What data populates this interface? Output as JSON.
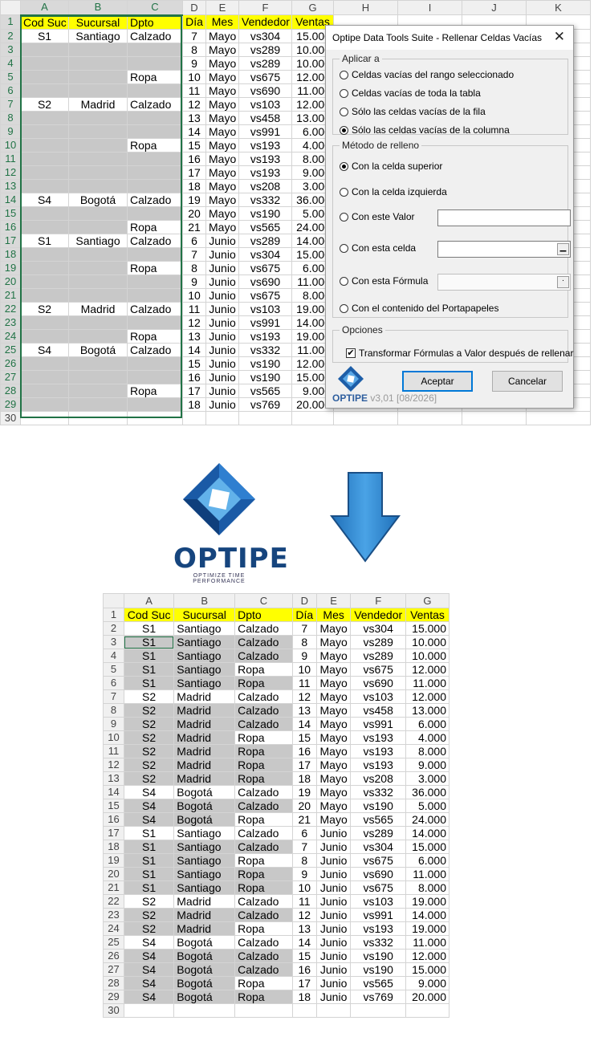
{
  "columns": [
    "A",
    "B",
    "C",
    "D",
    "E",
    "F",
    "G",
    "H",
    "I",
    "J",
    "K"
  ],
  "headers": [
    "Cod Suc",
    "Sucursal",
    "Dpto",
    "Día",
    "Mes",
    "Vendedor",
    "Ventas"
  ],
  "rows_before": [
    {
      "n": "2",
      "a": "S1",
      "b": "Santiago",
      "c": "Calzado",
      "d": "7",
      "e": "Mayo",
      "f": "vs304",
      "g": "15.000"
    },
    {
      "n": "3",
      "a": "",
      "b": "",
      "c": "",
      "d": "8",
      "e": "Mayo",
      "f": "vs289",
      "g": "10.000"
    },
    {
      "n": "4",
      "a": "",
      "b": "",
      "c": "",
      "d": "9",
      "e": "Mayo",
      "f": "vs289",
      "g": "10.000"
    },
    {
      "n": "5",
      "a": "",
      "b": "",
      "c": "Ropa",
      "d": "10",
      "e": "Mayo",
      "f": "vs675",
      "g": "12.000"
    },
    {
      "n": "6",
      "a": "",
      "b": "",
      "c": "",
      "d": "11",
      "e": "Mayo",
      "f": "vs690",
      "g": "11.000"
    },
    {
      "n": "7",
      "a": "S2",
      "b": "Madrid",
      "c": "Calzado",
      "d": "12",
      "e": "Mayo",
      "f": "vs103",
      "g": "12.000"
    },
    {
      "n": "8",
      "a": "",
      "b": "",
      "c": "",
      "d": "13",
      "e": "Mayo",
      "f": "vs458",
      "g": "13.000"
    },
    {
      "n": "9",
      "a": "",
      "b": "",
      "c": "",
      "d": "14",
      "e": "Mayo",
      "f": "vs991",
      "g": "6.000"
    },
    {
      "n": "10",
      "a": "",
      "b": "",
      "c": "Ropa",
      "d": "15",
      "e": "Mayo",
      "f": "vs193",
      "g": "4.000"
    },
    {
      "n": "11",
      "a": "",
      "b": "",
      "c": "",
      "d": "16",
      "e": "Mayo",
      "f": "vs193",
      "g": "8.000"
    },
    {
      "n": "12",
      "a": "",
      "b": "",
      "c": "",
      "d": "17",
      "e": "Mayo",
      "f": "vs193",
      "g": "9.000"
    },
    {
      "n": "13",
      "a": "",
      "b": "",
      "c": "",
      "d": "18",
      "e": "Mayo",
      "f": "vs208",
      "g": "3.000"
    },
    {
      "n": "14",
      "a": "S4",
      "b": "Bogotá",
      "c": "Calzado",
      "d": "19",
      "e": "Mayo",
      "f": "vs332",
      "g": "36.000"
    },
    {
      "n": "15",
      "a": "",
      "b": "",
      "c": "",
      "d": "20",
      "e": "Mayo",
      "f": "vs190",
      "g": "5.000"
    },
    {
      "n": "16",
      "a": "",
      "b": "",
      "c": "Ropa",
      "d": "21",
      "e": "Mayo",
      "f": "vs565",
      "g": "24.000"
    },
    {
      "n": "17",
      "a": "S1",
      "b": "Santiago",
      "c": "Calzado",
      "d": "6",
      "e": "Junio",
      "f": "vs289",
      "g": "14.000"
    },
    {
      "n": "18",
      "a": "",
      "b": "",
      "c": "",
      "d": "7",
      "e": "Junio",
      "f": "vs304",
      "g": "15.000"
    },
    {
      "n": "19",
      "a": "",
      "b": "",
      "c": "Ropa",
      "d": "8",
      "e": "Junio",
      "f": "vs675",
      "g": "6.000"
    },
    {
      "n": "20",
      "a": "",
      "b": "",
      "c": "",
      "d": "9",
      "e": "Junio",
      "f": "vs690",
      "g": "11.000"
    },
    {
      "n": "21",
      "a": "",
      "b": "",
      "c": "",
      "d": "10",
      "e": "Junio",
      "f": "vs675",
      "g": "8.000"
    },
    {
      "n": "22",
      "a": "S2",
      "b": "Madrid",
      "c": "Calzado",
      "d": "11",
      "e": "Junio",
      "f": "vs103",
      "g": "19.000"
    },
    {
      "n": "23",
      "a": "",
      "b": "",
      "c": "",
      "d": "12",
      "e": "Junio",
      "f": "vs991",
      "g": "14.000"
    },
    {
      "n": "24",
      "a": "",
      "b": "",
      "c": "Ropa",
      "d": "13",
      "e": "Junio",
      "f": "vs193",
      "g": "19.000"
    },
    {
      "n": "25",
      "a": "S4",
      "b": "Bogotá",
      "c": "Calzado",
      "d": "14",
      "e": "Junio",
      "f": "vs332",
      "g": "11.000"
    },
    {
      "n": "26",
      "a": "",
      "b": "",
      "c": "",
      "d": "15",
      "e": "Junio",
      "f": "vs190",
      "g": "12.000"
    },
    {
      "n": "27",
      "a": "",
      "b": "",
      "c": "",
      "d": "16",
      "e": "Junio",
      "f": "vs190",
      "g": "15.000"
    },
    {
      "n": "28",
      "a": "",
      "b": "",
      "c": "Ropa",
      "d": "17",
      "e": "Junio",
      "f": "vs565",
      "g": "9.000"
    },
    {
      "n": "29",
      "a": "",
      "b": "",
      "c": "",
      "d": "18",
      "e": "Junio",
      "f": "vs769",
      "g": "20.000"
    }
  ],
  "rows_after": [
    {
      "n": "2",
      "a": "S1",
      "b": "Santiago",
      "c": "Calzado",
      "d": "7",
      "e": "Mayo",
      "f": "vs304",
      "g": "15.000",
      "fa": 0,
      "fc": 0
    },
    {
      "n": "3",
      "a": "S1",
      "b": "Santiago",
      "c": "Calzado",
      "d": "8",
      "e": "Mayo",
      "f": "vs289",
      "g": "10.000",
      "fa": 1,
      "fc": 1
    },
    {
      "n": "4",
      "a": "S1",
      "b": "Santiago",
      "c": "Calzado",
      "d": "9",
      "e": "Mayo",
      "f": "vs289",
      "g": "10.000",
      "fa": 1,
      "fc": 1
    },
    {
      "n": "5",
      "a": "S1",
      "b": "Santiago",
      "c": "Ropa",
      "d": "10",
      "e": "Mayo",
      "f": "vs675",
      "g": "12.000",
      "fa": 1,
      "fc": 0
    },
    {
      "n": "6",
      "a": "S1",
      "b": "Santiago",
      "c": "Ropa",
      "d": "11",
      "e": "Mayo",
      "f": "vs690",
      "g": "11.000",
      "fa": 1,
      "fc": 1
    },
    {
      "n": "7",
      "a": "S2",
      "b": "Madrid",
      "c": "Calzado",
      "d": "12",
      "e": "Mayo",
      "f": "vs103",
      "g": "12.000",
      "fa": 0,
      "fc": 0
    },
    {
      "n": "8",
      "a": "S2",
      "b": "Madrid",
      "c": "Calzado",
      "d": "13",
      "e": "Mayo",
      "f": "vs458",
      "g": "13.000",
      "fa": 1,
      "fc": 1
    },
    {
      "n": "9",
      "a": "S2",
      "b": "Madrid",
      "c": "Calzado",
      "d": "14",
      "e": "Mayo",
      "f": "vs991",
      "g": "6.000",
      "fa": 1,
      "fc": 1
    },
    {
      "n": "10",
      "a": "S2",
      "b": "Madrid",
      "c": "Ropa",
      "d": "15",
      "e": "Mayo",
      "f": "vs193",
      "g": "4.000",
      "fa": 1,
      "fc": 0
    },
    {
      "n": "11",
      "a": "S2",
      "b": "Madrid",
      "c": "Ropa",
      "d": "16",
      "e": "Mayo",
      "f": "vs193",
      "g": "8.000",
      "fa": 1,
      "fc": 1
    },
    {
      "n": "12",
      "a": "S2",
      "b": "Madrid",
      "c": "Ropa",
      "d": "17",
      "e": "Mayo",
      "f": "vs193",
      "g": "9.000",
      "fa": 1,
      "fc": 1
    },
    {
      "n": "13",
      "a": "S2",
      "b": "Madrid",
      "c": "Ropa",
      "d": "18",
      "e": "Mayo",
      "f": "vs208",
      "g": "3.000",
      "fa": 1,
      "fc": 1
    },
    {
      "n": "14",
      "a": "S4",
      "b": "Bogotá",
      "c": "Calzado",
      "d": "19",
      "e": "Mayo",
      "f": "vs332",
      "g": "36.000",
      "fa": 0,
      "fc": 0
    },
    {
      "n": "15",
      "a": "S4",
      "b": "Bogotá",
      "c": "Calzado",
      "d": "20",
      "e": "Mayo",
      "f": "vs190",
      "g": "5.000",
      "fa": 1,
      "fc": 1
    },
    {
      "n": "16",
      "a": "S4",
      "b": "Bogotá",
      "c": "Ropa",
      "d": "21",
      "e": "Mayo",
      "f": "vs565",
      "g": "24.000",
      "fa": 1,
      "fc": 0
    },
    {
      "n": "17",
      "a": "S1",
      "b": "Santiago",
      "c": "Calzado",
      "d": "6",
      "e": "Junio",
      "f": "vs289",
      "g": "14.000",
      "fa": 0,
      "fc": 0
    },
    {
      "n": "18",
      "a": "S1",
      "b": "Santiago",
      "c": "Calzado",
      "d": "7",
      "e": "Junio",
      "f": "vs304",
      "g": "15.000",
      "fa": 1,
      "fc": 1
    },
    {
      "n": "19",
      "a": "S1",
      "b": "Santiago",
      "c": "Ropa",
      "d": "8",
      "e": "Junio",
      "f": "vs675",
      "g": "6.000",
      "fa": 1,
      "fc": 0
    },
    {
      "n": "20",
      "a": "S1",
      "b": "Santiago",
      "c": "Ropa",
      "d": "9",
      "e": "Junio",
      "f": "vs690",
      "g": "11.000",
      "fa": 1,
      "fc": 1
    },
    {
      "n": "21",
      "a": "S1",
      "b": "Santiago",
      "c": "Ropa",
      "d": "10",
      "e": "Junio",
      "f": "vs675",
      "g": "8.000",
      "fa": 1,
      "fc": 1
    },
    {
      "n": "22",
      "a": "S2",
      "b": "Madrid",
      "c": "Calzado",
      "d": "11",
      "e": "Junio",
      "f": "vs103",
      "g": "19.000",
      "fa": 0,
      "fc": 0
    },
    {
      "n": "23",
      "a": "S2",
      "b": "Madrid",
      "c": "Calzado",
      "d": "12",
      "e": "Junio",
      "f": "vs991",
      "g": "14.000",
      "fa": 1,
      "fc": 1
    },
    {
      "n": "24",
      "a": "S2",
      "b": "Madrid",
      "c": "Ropa",
      "d": "13",
      "e": "Junio",
      "f": "vs193",
      "g": "19.000",
      "fa": 1,
      "fc": 0
    },
    {
      "n": "25",
      "a": "S4",
      "b": "Bogotá",
      "c": "Calzado",
      "d": "14",
      "e": "Junio",
      "f": "vs332",
      "g": "11.000",
      "fa": 0,
      "fc": 0
    },
    {
      "n": "26",
      "a": "S4",
      "b": "Bogotá",
      "c": "Calzado",
      "d": "15",
      "e": "Junio",
      "f": "vs190",
      "g": "12.000",
      "fa": 1,
      "fc": 1
    },
    {
      "n": "27",
      "a": "S4",
      "b": "Bogotá",
      "c": "Calzado",
      "d": "16",
      "e": "Junio",
      "f": "vs190",
      "g": "15.000",
      "fa": 1,
      "fc": 1
    },
    {
      "n": "28",
      "a": "S4",
      "b": "Bogotá",
      "c": "Ropa",
      "d": "17",
      "e": "Junio",
      "f": "vs565",
      "g": "9.000",
      "fa": 1,
      "fc": 0
    },
    {
      "n": "29",
      "a": "S4",
      "b": "Bogotá",
      "c": "Ropa",
      "d": "18",
      "e": "Junio",
      "f": "vs769",
      "g": "20.000",
      "fa": 1,
      "fc": 1
    }
  ],
  "last_row": "30",
  "dialog": {
    "title": "Optipe Data Tools Suite - Rellenar Celdas Vacías",
    "close_glyph": "✕",
    "apply_group": "Aplicar a",
    "apply_options": [
      "Celdas vacías del rango seleccionado",
      "Celdas vacías de toda la tabla",
      "Sólo las celdas vacías de la fila",
      "Sólo las celdas vacías de la columna"
    ],
    "apply_selected": 3,
    "method_group": "Método de relleno",
    "method_options": [
      "Con la celda superior",
      "Con la celda izquierda",
      "Con este Valor",
      "Con esta celda",
      "Con esta Fórmula",
      "Con el contenido del Portapapeles"
    ],
    "method_selected": 0,
    "options_group": "Opciones",
    "checkbox_label": "Transformar Fórmulas a Valor después de rellenar",
    "checkbox_checked": true,
    "accept": "Aceptar",
    "cancel": "Cancelar",
    "brand": "OPTIPE",
    "version": "v3,01 [08/2026]"
  },
  "logo": {
    "name": "OPTIPE",
    "tagline": "OPTIMIZE TIME PERFORMANCE"
  },
  "colors": {
    "header_yellow": "#ffff00",
    "filled_gray": "#c8c8c8",
    "excel_green": "#217346",
    "logo_blue": "#16457e",
    "arrow_blue": "#2a86d1"
  }
}
